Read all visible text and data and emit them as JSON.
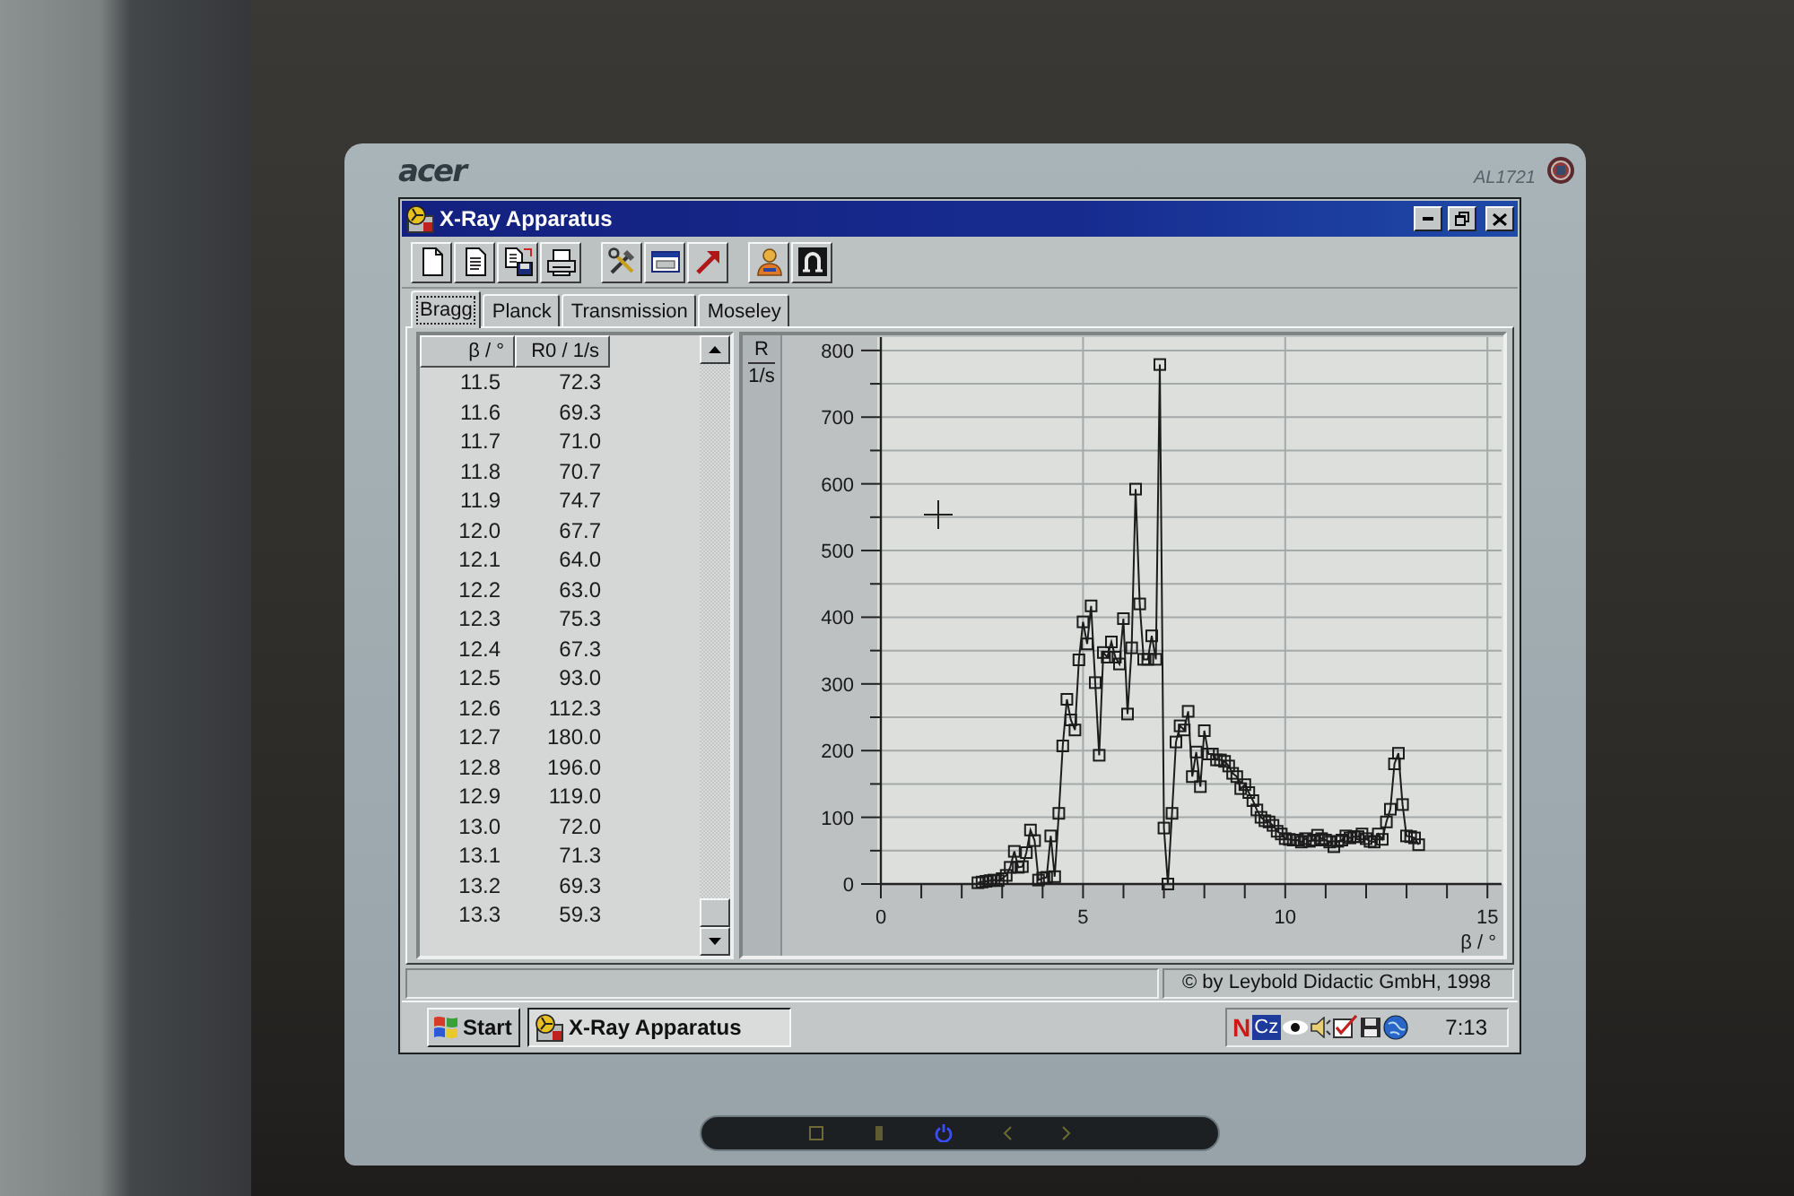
{
  "monitor": {
    "brand": "acer",
    "model": "AL1721"
  },
  "window": {
    "title": "X-Ray Apparatus"
  },
  "tabs": [
    {
      "label": "Bragg",
      "selected": true
    },
    {
      "label": "Planck",
      "selected": false
    },
    {
      "label": "Transmission",
      "selected": false
    },
    {
      "label": "Moseley",
      "selected": false
    }
  ],
  "table": {
    "columns": [
      "β / °",
      "R0 / 1/s"
    ],
    "rows": [
      [
        "11.5",
        "72.3"
      ],
      [
        "11.6",
        "69.3"
      ],
      [
        "11.7",
        "71.0"
      ],
      [
        "11.8",
        "70.7"
      ],
      [
        "11.9",
        "74.7"
      ],
      [
        "12.0",
        "67.7"
      ],
      [
        "12.1",
        "64.0"
      ],
      [
        "12.2",
        "63.0"
      ],
      [
        "12.3",
        "75.3"
      ],
      [
        "12.4",
        "67.3"
      ],
      [
        "12.5",
        "93.0"
      ],
      [
        "12.6",
        "112.3"
      ],
      [
        "12.7",
        "180.0"
      ],
      [
        "12.8",
        "196.0"
      ],
      [
        "12.9",
        "119.0"
      ],
      [
        "13.0",
        "72.0"
      ],
      [
        "13.1",
        "71.3"
      ],
      [
        "13.2",
        "69.3"
      ],
      [
        "13.3",
        "59.3"
      ]
    ]
  },
  "chart": {
    "y_unit": "1/s",
    "chart_data": {
      "type": "line",
      "xlabel": "β / °",
      "ylabel": "R",
      "grid": true,
      "x": [
        2.4,
        2.5,
        2.6,
        2.7,
        2.8,
        2.9,
        3.0,
        3.1,
        3.2,
        3.3,
        3.4,
        3.5,
        3.6,
        3.7,
        3.8,
        3.9,
        4.0,
        4.1,
        4.2,
        4.3,
        4.4,
        4.5,
        4.6,
        4.7,
        4.8,
        4.9,
        5.0,
        5.1,
        5.2,
        5.3,
        5.4,
        5.5,
        5.6,
        5.7,
        5.8,
        5.9,
        6.0,
        6.1,
        6.2,
        6.3,
        6.4,
        6.5,
        6.6,
        6.7,
        6.8,
        6.9,
        7.0,
        7.1,
        7.2,
        7.3,
        7.4,
        7.5,
        7.6,
        7.7,
        7.8,
        7.9,
        8.0,
        8.1,
        8.2,
        8.3,
        8.4,
        8.5,
        8.6,
        8.7,
        8.8,
        8.9,
        9.0,
        9.1,
        9.2,
        9.3,
        9.4,
        9.5,
        9.6,
        9.7,
        9.8,
        9.9,
        10.0,
        10.1,
        10.2,
        10.3,
        10.4,
        10.5,
        10.6,
        10.7,
        10.8,
        10.9,
        11.0,
        11.1,
        11.2,
        11.3,
        11.4,
        11.5,
        11.6,
        11.7,
        11.8,
        11.9,
        12.0,
        12.1,
        12.2,
        12.3,
        12.4,
        12.5,
        12.6,
        12.7,
        12.8,
        12.9,
        13.0,
        13.1,
        13.2,
        13.3
      ],
      "series": [
        {
          "color": "#1c1c1c",
          "marker": "square",
          "values": [
            2,
            3,
            4,
            5,
            6,
            5,
            8,
            13,
            25,
            49,
            25,
            26,
            47,
            81,
            65,
            6,
            9,
            10,
            72,
            11,
            106,
            207,
            277,
            246,
            231,
            336,
            393,
            360,
            417,
            302,
            193,
            347,
            340,
            363,
            340,
            330,
            398,
            255,
            354,
            592,
            420,
            337,
            337,
            372,
            337,
            779,
            84,
            0,
            106,
            213,
            237,
            231,
            259,
            161,
            198,
            146,
            230,
            195,
            195,
            186,
            186,
            184,
            177,
            166,
            161,
            143,
            149,
            137,
            125,
            111,
            100,
            95,
            93,
            88,
            79,
            75,
            68,
            67,
            66,
            66,
            63,
            68,
            64,
            66,
            73,
            68,
            66,
            63,
            56,
            64,
            66,
            72,
            69,
            71,
            71,
            75,
            68,
            64,
            63,
            75,
            67,
            93,
            112,
            180,
            196,
            119,
            72,
            71,
            69,
            59
          ]
        }
      ],
      "xlim": [
        0,
        15.35
      ],
      "ylim": [
        0,
        820
      ],
      "xticks": [
        0,
        5,
        10,
        15
      ],
      "yticks": [
        0,
        100,
        200,
        300,
        400,
        500,
        600,
        700,
        800
      ]
    }
  },
  "status_bar": {
    "text": "© by Leybold Didactic GmbH, 1998"
  },
  "taskbar": {
    "start": "Start",
    "tasks": [
      {
        "label": "X-Ray Apparatus",
        "selected": true
      }
    ],
    "tray": [
      {
        "kind": "logo",
        "text": "N"
      },
      {
        "kind": "language",
        "text": "Cz"
      }
    ],
    "clock": "7:13"
  }
}
